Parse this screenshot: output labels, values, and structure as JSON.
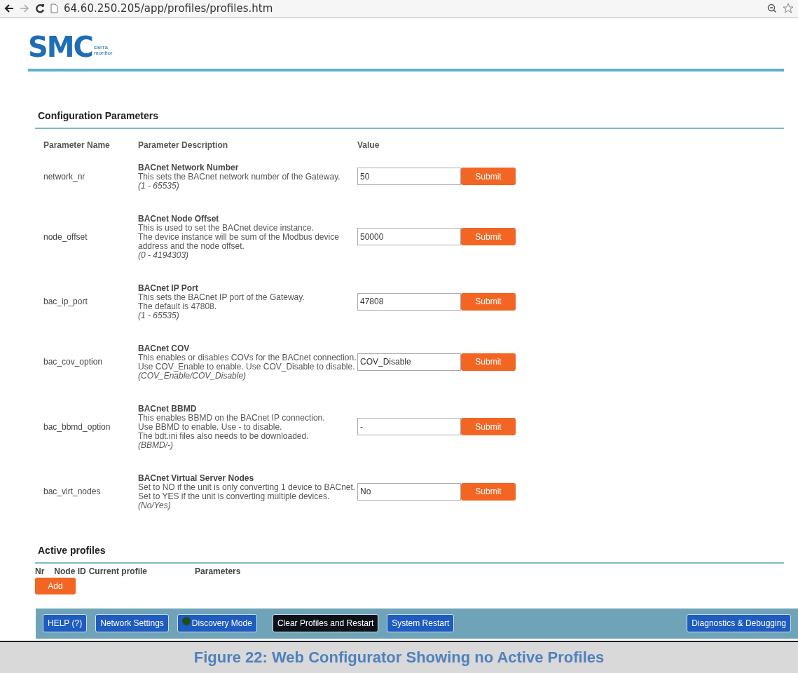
{
  "browser": {
    "url": "64.60.250.205/app/profiles/profiles.htm"
  },
  "logo": {
    "letters": "SMC",
    "line1": "sierra",
    "line2": "monitor"
  },
  "config": {
    "title": "Configuration Parameters",
    "columns": [
      "Parameter Name",
      "Parameter Description",
      "Value"
    ],
    "params": [
      {
        "name": "network_nr",
        "title": "BACnet Network Number",
        "lines": [
          "This sets the BACnet network number of the Gateway."
        ],
        "range": "(1 - 65535)",
        "value": "50",
        "button": "Submit"
      },
      {
        "name": "node_offset",
        "title": "BACnet Node Offset",
        "lines": [
          "This is used to set the BACnet device instance.",
          "The device instance will be sum of the Modbus device address and the node offset."
        ],
        "range": "(0 - 4194303)",
        "value": "50000",
        "button": "Submit"
      },
      {
        "name": "bac_ip_port",
        "title": "BACnet IP Port",
        "lines": [
          "This sets the BACnet IP port of the Gateway.",
          "The default is 47808."
        ],
        "range": "(1 - 65535)",
        "value": "47808",
        "button": "Submit"
      },
      {
        "name": "bac_cov_option",
        "title": "BACnet COV",
        "lines": [
          "This enables or disables COVs for the BACnet connection.",
          "Use COV_Enable to enable. Use COV_Disable to disable."
        ],
        "range": "(COV_Enable/COV_Disable)",
        "value": "COV_Disable",
        "button": "Submit"
      },
      {
        "name": "bac_bbmd_option",
        "title": "BACnet BBMD",
        "lines": [
          "This enables BBMD on the BACnet IP connection.",
          "Use BBMD to enable. Use - to disable.",
          "The bdt.ini files also needs to be downloaded."
        ],
        "range": "(BBMD/-)",
        "value": "-",
        "button": "Submit"
      },
      {
        "name": "bac_virt_nodes",
        "title": "BACnet Virtual Server Nodes",
        "lines": [
          "Set to NO if the unit is only converting 1 device to BACnet.",
          "Set to YES if the unit is converting multiple devices."
        ],
        "range": "(No/Yes)",
        "value": "No",
        "button": "Submit"
      }
    ]
  },
  "profiles": {
    "title": "Active profiles",
    "columns": [
      "Nr",
      "Node ID",
      "Current profile",
      "Parameters"
    ],
    "add_button": "Add"
  },
  "footer": {
    "buttons": [
      {
        "label": "HELP (?)",
        "kind": "nav"
      },
      {
        "label": "Network Settings",
        "kind": "nav"
      },
      {
        "label": "Discovery Mode",
        "kind": "indicator",
        "on": false
      },
      {
        "label": "Clear Profiles and Restart",
        "kind": "dark"
      },
      {
        "label": "System Restart",
        "kind": "nav"
      }
    ],
    "right_button": {
      "label": "Diagnostics & Debugging"
    }
  },
  "caption": "Figure 22: Web Configurator Showing no Active Profiles"
}
